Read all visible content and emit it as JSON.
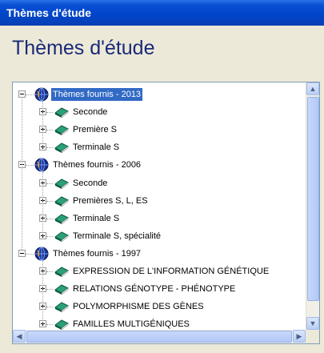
{
  "window": {
    "title": "Thèmes d'étude"
  },
  "page": {
    "heading": "Thèmes d'étude"
  },
  "tree": {
    "groups": [
      {
        "label": "Thèmes fournis - 2013",
        "selected": true,
        "children": [
          "Seconde",
          "Première S",
          "Terminale S"
        ]
      },
      {
        "label": "Thèmes fournis - 2006",
        "selected": false,
        "children": [
          "Seconde",
          "Premières S, L, ES",
          "Terminale S",
          "Terminale S, spécialité"
        ]
      },
      {
        "label": "Thèmes fournis - 1997",
        "selected": false,
        "children": [
          "EXPRESSION DE L'INFORMATION GÉNÉTIQUE",
          "RELATIONS GÉNOTYPE - PHÉNOTYPE",
          "POLYMORPHISME DES GÈNES",
          "FAMILLES MULTIGÉNIQUES"
        ]
      }
    ]
  },
  "icons": {
    "group": "globe-icon",
    "item": "book-icon"
  },
  "colors": {
    "titlebar": "#0a4fd4",
    "heading": "#1a2a78",
    "selection": "#316ac5",
    "book": "#1f8a64"
  }
}
